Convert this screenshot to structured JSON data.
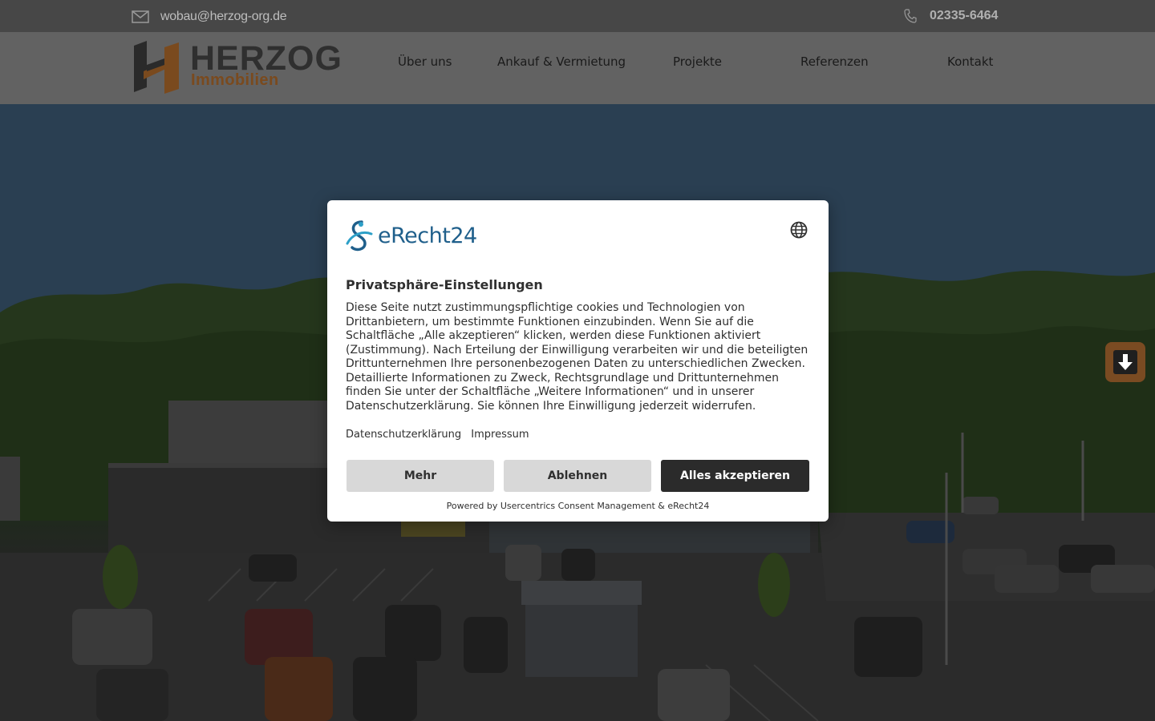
{
  "topbar": {
    "email": "wobau@herzog-org.de",
    "phone": "02335-6464",
    "mail_icon": "envelope-icon",
    "phone_icon": "phone-icon"
  },
  "header": {
    "logo_brand": "HERZOG",
    "logo_sub": "Immobilien",
    "nav": [
      {
        "label": "Über uns"
      },
      {
        "label": "Ankauf & Vermietung"
      },
      {
        "label": "Projekte"
      },
      {
        "label": "Referenzen"
      },
      {
        "label": "Kontakt"
      }
    ]
  },
  "hero": {
    "scroll_icon": "arrow-down-icon"
  },
  "consent": {
    "logo_text": "eRecht24",
    "language_icon": "globe-icon",
    "title": "Privatsphäre-Einstellungen",
    "body": "Diese Seite nutzt zustimmungspflichtige cookies und Technologien von Drittanbietern, um bestimmte Funktionen einzubinden. Wenn Sie auf die Schaltfläche „Alle akzeptieren“ klicken, werden diese Funktionen aktiviert (Zustimmung). Nach Erteilung der Einwilligung verarbeiten wir und die beteiligten Drittunternehmen Ihre personenbezogenen Daten zu unterschiedlichen Zwecken. Detaillierte Informationen zu Zweck, Rechtsgrundlage und Drittunternehmen finden Sie unter der Schaltfläche „Weitere Informationen“ und in unserer Datenschutzerklärung. Sie können Ihre Einwilligung jederzeit widerrufen.",
    "links": {
      "privacy": "Datenschutzerklärung",
      "imprint": "Impressum"
    },
    "buttons": {
      "more": "Mehr",
      "reject": "Ablehnen",
      "accept_all": "Alles akzeptieren"
    },
    "powered_by": "Powered by Usercentrics Consent Management & eRecht24"
  },
  "colors": {
    "accent_orange": "#c97a3a",
    "dark_button": "#2b2b2b",
    "gray_button": "#d8d8d8",
    "brand_blue": "#1f5f8b"
  }
}
